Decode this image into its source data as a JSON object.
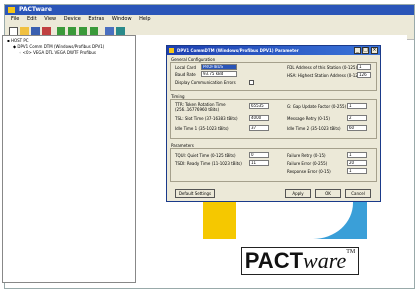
{
  "app": {
    "title": "PACTware",
    "menu": [
      "File",
      "Edit",
      "View",
      "Device",
      "Extras",
      "Window",
      "Help"
    ]
  },
  "tree": {
    "root": "HOST PC",
    "node1": "DPV1 Comm DTM (Windows/Profibus DPV1)",
    "node2": "<0> VEGA DTL VEGA DWTF Profibus"
  },
  "dialog": {
    "title": "DPV1 CommDTM (Windows/Profibus DPV1) Parameter",
    "general": {
      "heading": "General Configuration",
      "local_card_label": "Local Card",
      "local_card_value": "PROFIBUS",
      "baud_rate_label": "Baud Rate",
      "baud_rate_value": "93.75 kBd",
      "display_label": "Display Communication Errors",
      "fdl_label": "FDL Address of this Station (0-125)",
      "fdl_value": "1",
      "hsa_label": "HSA: Highest Station Address (0-126)",
      "hsa_value": "126"
    },
    "timing": {
      "heading": "Timing",
      "ttr_label": "TTR: Token Rotation Time",
      "ttr_sub": "(256..16776960 tBits)",
      "ttr_value": "65535",
      "sl_label": "TSL: Slot Time (37-16383 tBits)",
      "sl_value": "4000",
      "idle1_label": "Idle Time 1 (35-1023 tBits)",
      "idle1_value": "37",
      "gap_label": "G: Gap Update Factor (0-255)",
      "gap_value": "1",
      "retry_label": "Message Retry (0-15)",
      "retry_value": "2",
      "idle2_label": "Idle Time 2 (35-1023 tBits)",
      "idle2_value": "60"
    },
    "params": {
      "heading": "Parameters",
      "tqui_label": "TQUI: Quiet Time (0-125 tBits)",
      "tqui_value": "0",
      "tsdi_label": "TSDI: Ready Time (11-1023 tBits)",
      "tsdi_value": "11",
      "fretry_label": "Failure Retry (0-15)",
      "fretry_value": "1",
      "ferror_label": "Failure Error (0-255)",
      "ferror_value": "20",
      "resp_label": "Response Error (0-15)",
      "resp_value": "1"
    },
    "buttons": {
      "defaults": "Default Settings",
      "apply": "Apply",
      "ok": "OK",
      "cancel": "Cancel"
    }
  },
  "brand": {
    "pact": "PACT",
    "ware": "ware",
    "tm": "TM"
  },
  "colors": {
    "titlebar": "#2a55b8",
    "logo_yellow": "#f5c800",
    "logo_blue": "#3a9fd8"
  }
}
